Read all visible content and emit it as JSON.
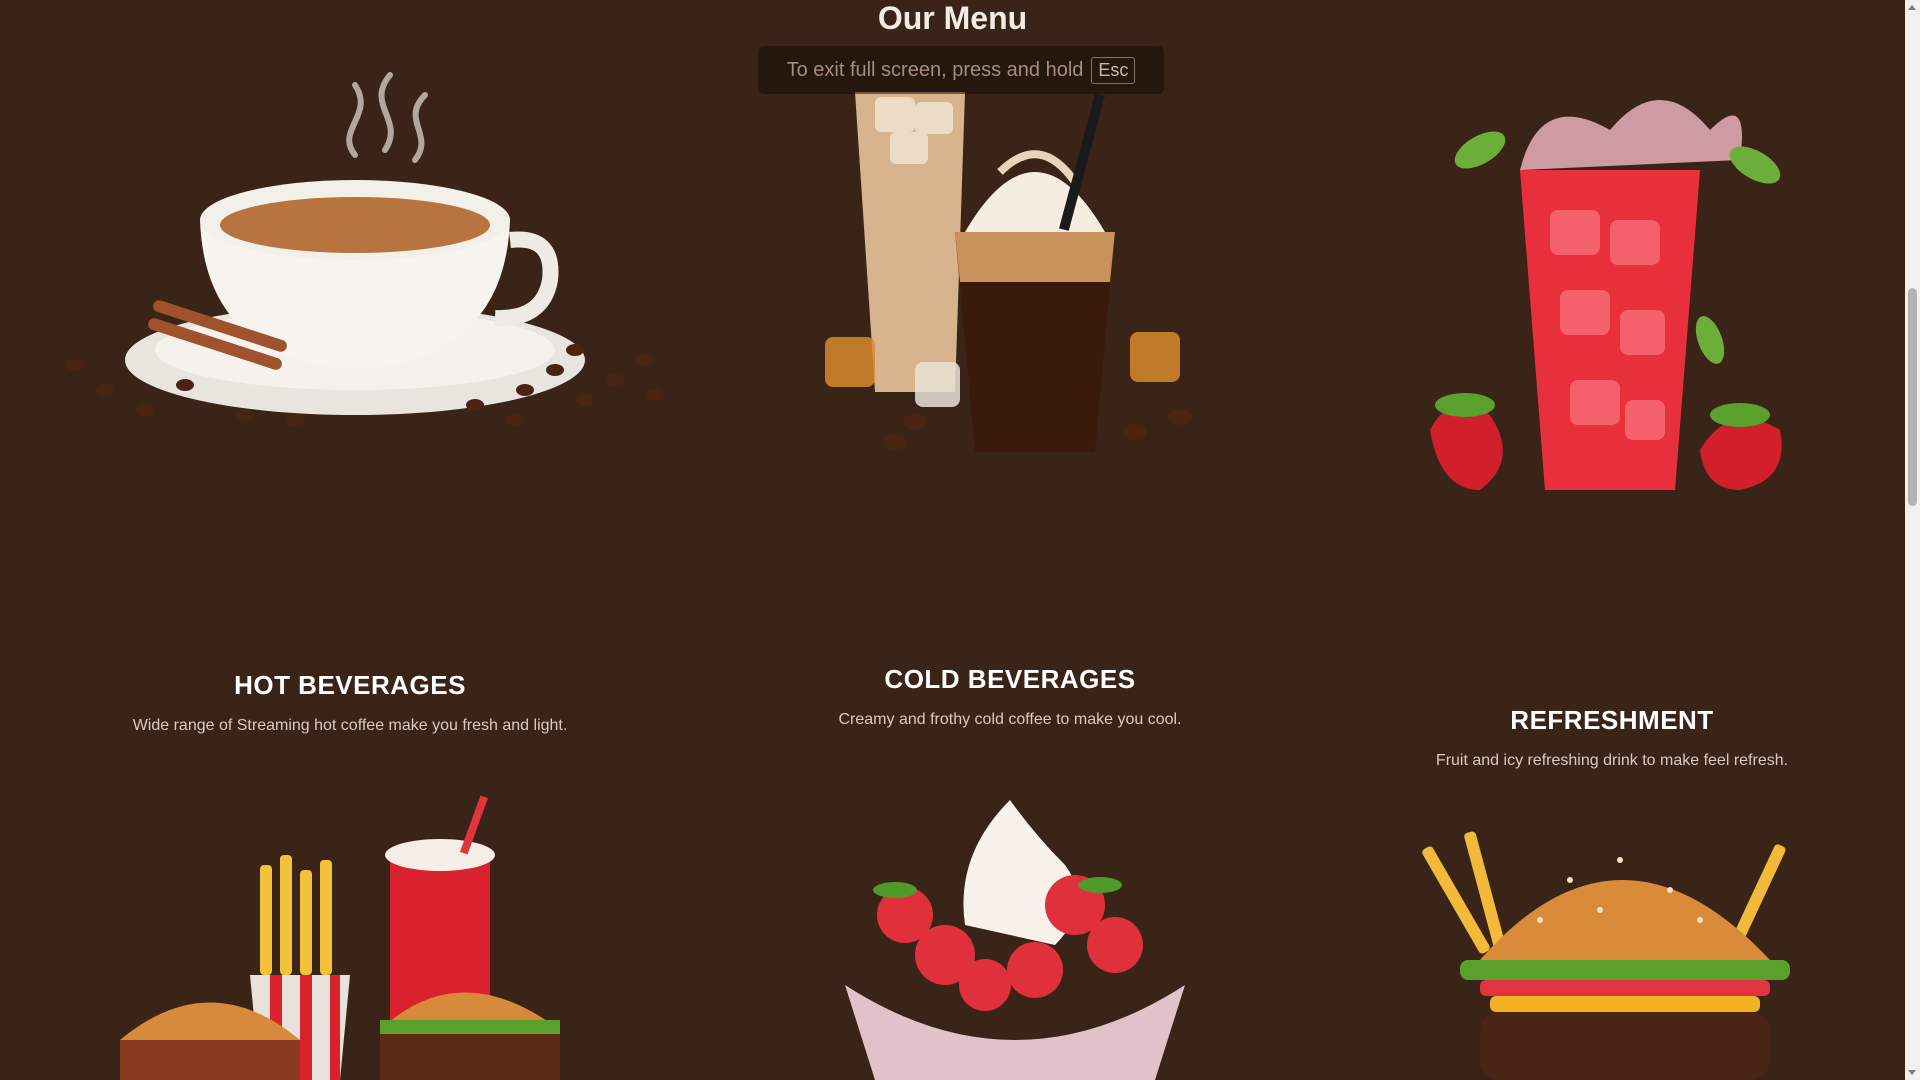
{
  "page": {
    "title": "Our Menu"
  },
  "fullscreen_notice": {
    "text": "To exit full screen, press and hold",
    "key": "Esc"
  },
  "menu": {
    "hot": {
      "title": "HOT BEVERAGES",
      "description": "Wide range of Streaming hot coffee make you fresh and light."
    },
    "cold": {
      "title": "COLD BEVERAGES",
      "description": "Creamy and frothy cold coffee to make you cool."
    },
    "refresh": {
      "title": "REFRESHMENT",
      "description": "Fruit and icy refreshing drink to make feel refresh."
    }
  },
  "colors": {
    "background": "#3a2417",
    "text": "#ffffff",
    "muted": "#d9cbbf"
  }
}
